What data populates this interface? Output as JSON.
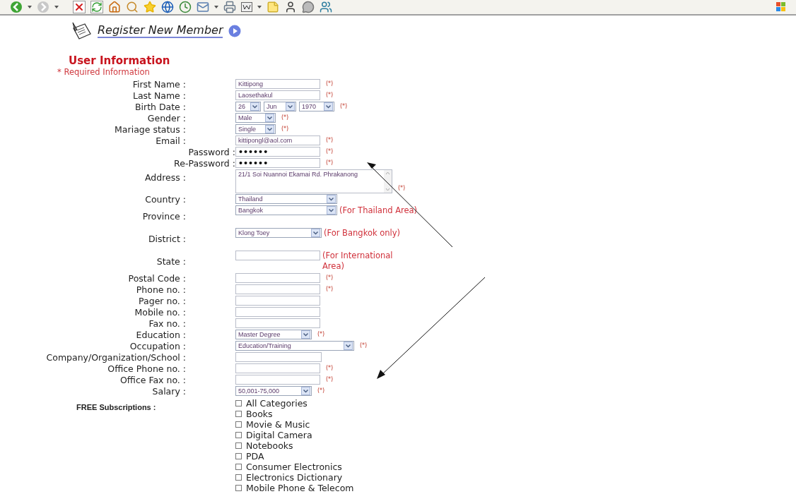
{
  "header": {
    "title": "Register New Member"
  },
  "section": {
    "title": "User Information",
    "required_note": "* Required Information"
  },
  "fields": [
    {
      "label": "First Name :",
      "kind": "text",
      "value": "Kittipong",
      "mark": "(*)"
    },
    {
      "label": "Last Name :",
      "kind": "text",
      "value": "Laosethakul",
      "mark": "(*)"
    },
    {
      "label": "Birth Date :",
      "kind": "date",
      "parts": [
        "26",
        "Jun",
        "1970"
      ],
      "mark": "(*)"
    },
    {
      "label": "Gender :",
      "kind": "select",
      "value": "Male",
      "mark": "(*)"
    },
    {
      "label": "Mariage status :",
      "kind": "select",
      "value": "Single",
      "mark": "(*)"
    },
    {
      "label": "Email :",
      "kind": "text",
      "value": "kittipongl@aol.com",
      "mark": "(*)"
    },
    {
      "label": "Password :",
      "kind": "password",
      "value": "••••••",
      "mark": "(*)"
    },
    {
      "label": "Re-Password :",
      "kind": "password",
      "value": "••••••",
      "mark": "(*)"
    },
    {
      "label": "Address :",
      "kind": "textarea",
      "value": "21/1 Soi Nuannoi Ekamai Rd. Phrakanong",
      "mark": "(*)"
    },
    {
      "label": "Country :",
      "kind": "select",
      "value": "Thailand"
    },
    {
      "label": "Province :",
      "kind": "select",
      "value": "Bangkok",
      "note": "(For Thailand Area)"
    },
    {
      "label": "District :",
      "kind": "select",
      "value": "Klong Toey",
      "note": "(For Bangkok only)"
    },
    {
      "label": "State :",
      "kind": "text",
      "note": "(For International Area)"
    },
    {
      "label": "Postal Code :",
      "kind": "text",
      "mark": "(*)"
    },
    {
      "label": "Phone no. :",
      "kind": "text",
      "mark": "(*)"
    },
    {
      "label": "Pager no. :",
      "kind": "text"
    },
    {
      "label": "Mobile no. :",
      "kind": "text"
    },
    {
      "label": "Fax no. :",
      "kind": "text"
    },
    {
      "label": "Education :",
      "kind": "select",
      "value": "Master Degree",
      "mark": "(*)"
    },
    {
      "label": "Occupation :",
      "kind": "select",
      "value": "Education/Training",
      "mark": "(*)"
    },
    {
      "label": "Company/Organization/School :",
      "kind": "wide"
    },
    {
      "label": "Office Phone no. :",
      "kind": "text",
      "mark": "(*)"
    },
    {
      "label": "Office Fax no. :",
      "kind": "text",
      "mark": "(*)"
    },
    {
      "label": "Salary :",
      "kind": "select",
      "value": "50,001-75,000",
      "mark": "(*)"
    }
  ],
  "subscriptions": {
    "label": "FREE Subscriptions :",
    "options": [
      {
        "label": "All Categories",
        "checked": false
      },
      {
        "label": "Books",
        "checked": false
      },
      {
        "label": "Movie & Music",
        "checked": false
      },
      {
        "label": "Digital Camera",
        "checked": false
      },
      {
        "label": "Notebooks",
        "checked": false
      },
      {
        "label": "PDA",
        "checked": false
      },
      {
        "label": "Consumer Electronics",
        "checked": false
      },
      {
        "label": "Electronics Dictionary",
        "checked": false
      },
      {
        "label": "Mobile Phone & Telecom",
        "checked": false
      }
    ]
  }
}
